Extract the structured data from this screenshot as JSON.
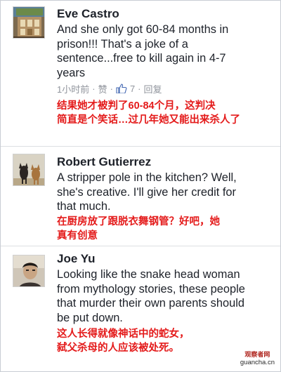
{
  "comments": [
    {
      "author": "Eve Castro",
      "avatar": "avatar-image",
      "lines": [
        "And she only got 60-84 months in",
        "prison!!! That's a joke of a",
        "sentence...free to kill again in 4-7",
        "years"
      ],
      "meta": {
        "time": "1小时前",
        "like_label": "赞",
        "like_icon": "thumbs-up-icon",
        "like_count": "7",
        "reply_label": "回复"
      },
      "translation": [
        "结果她才被判了60-84个月，这判决",
        "简直是个笑话…过几年她又能出来杀人了"
      ]
    },
    {
      "author": "Robert Gutierrez",
      "avatar": "avatar-image",
      "lines": [
        "A stripper pole in the kitchen? Well,",
        "she's creative. I'll give her credit for",
        "that much."
      ],
      "translation": [
        "在厨房放了跟脱衣舞钢管？好吧，她",
        "真有创意"
      ]
    },
    {
      "author": "Joe Yu",
      "avatar": "avatar-image",
      "lines": [
        "Looking like the snake head woman",
        "from mythology stories, these people",
        "that murder their own parents should",
        "be put down."
      ],
      "translation": [
        "这人长得就像神话中的蛇女，",
        "弑父杀母的人应该被处死。"
      ]
    }
  ],
  "watermark": {
    "line1": "观察者网",
    "line2": "guancha.cn"
  },
  "colors": {
    "translation": "#e41b1b",
    "meta": "#90949c",
    "like_blue": "#4267b2"
  }
}
